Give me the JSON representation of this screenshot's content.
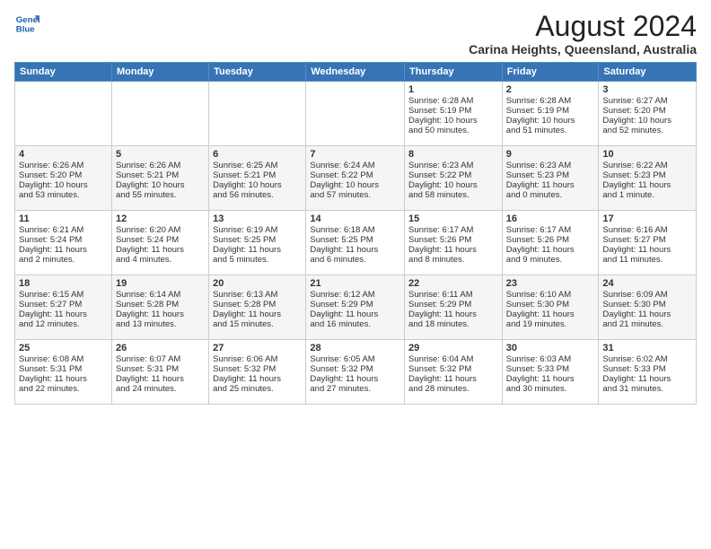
{
  "header": {
    "logo_line1": "General",
    "logo_line2": "Blue",
    "main_title": "August 2024",
    "sub_title": "Carina Heights, Queensland, Australia"
  },
  "days_of_week": [
    "Sunday",
    "Monday",
    "Tuesday",
    "Wednesday",
    "Thursday",
    "Friday",
    "Saturday"
  ],
  "weeks": [
    [
      {
        "day": "",
        "content": ""
      },
      {
        "day": "",
        "content": ""
      },
      {
        "day": "",
        "content": ""
      },
      {
        "day": "",
        "content": ""
      },
      {
        "day": "1",
        "content": "Sunrise: 6:28 AM\nSunset: 5:19 PM\nDaylight: 10 hours\nand 50 minutes."
      },
      {
        "day": "2",
        "content": "Sunrise: 6:28 AM\nSunset: 5:19 PM\nDaylight: 10 hours\nand 51 minutes."
      },
      {
        "day": "3",
        "content": "Sunrise: 6:27 AM\nSunset: 5:20 PM\nDaylight: 10 hours\nand 52 minutes."
      }
    ],
    [
      {
        "day": "4",
        "content": "Sunrise: 6:26 AM\nSunset: 5:20 PM\nDaylight: 10 hours\nand 53 minutes."
      },
      {
        "day": "5",
        "content": "Sunrise: 6:26 AM\nSunset: 5:21 PM\nDaylight: 10 hours\nand 55 minutes."
      },
      {
        "day": "6",
        "content": "Sunrise: 6:25 AM\nSunset: 5:21 PM\nDaylight: 10 hours\nand 56 minutes."
      },
      {
        "day": "7",
        "content": "Sunrise: 6:24 AM\nSunset: 5:22 PM\nDaylight: 10 hours\nand 57 minutes."
      },
      {
        "day": "8",
        "content": "Sunrise: 6:23 AM\nSunset: 5:22 PM\nDaylight: 10 hours\nand 58 minutes."
      },
      {
        "day": "9",
        "content": "Sunrise: 6:23 AM\nSunset: 5:23 PM\nDaylight: 11 hours\nand 0 minutes."
      },
      {
        "day": "10",
        "content": "Sunrise: 6:22 AM\nSunset: 5:23 PM\nDaylight: 11 hours\nand 1 minute."
      }
    ],
    [
      {
        "day": "11",
        "content": "Sunrise: 6:21 AM\nSunset: 5:24 PM\nDaylight: 11 hours\nand 2 minutes."
      },
      {
        "day": "12",
        "content": "Sunrise: 6:20 AM\nSunset: 5:24 PM\nDaylight: 11 hours\nand 4 minutes."
      },
      {
        "day": "13",
        "content": "Sunrise: 6:19 AM\nSunset: 5:25 PM\nDaylight: 11 hours\nand 5 minutes."
      },
      {
        "day": "14",
        "content": "Sunrise: 6:18 AM\nSunset: 5:25 PM\nDaylight: 11 hours\nand 6 minutes."
      },
      {
        "day": "15",
        "content": "Sunrise: 6:17 AM\nSunset: 5:26 PM\nDaylight: 11 hours\nand 8 minutes."
      },
      {
        "day": "16",
        "content": "Sunrise: 6:17 AM\nSunset: 5:26 PM\nDaylight: 11 hours\nand 9 minutes."
      },
      {
        "day": "17",
        "content": "Sunrise: 6:16 AM\nSunset: 5:27 PM\nDaylight: 11 hours\nand 11 minutes."
      }
    ],
    [
      {
        "day": "18",
        "content": "Sunrise: 6:15 AM\nSunset: 5:27 PM\nDaylight: 11 hours\nand 12 minutes."
      },
      {
        "day": "19",
        "content": "Sunrise: 6:14 AM\nSunset: 5:28 PM\nDaylight: 11 hours\nand 13 minutes."
      },
      {
        "day": "20",
        "content": "Sunrise: 6:13 AM\nSunset: 5:28 PM\nDaylight: 11 hours\nand 15 minutes."
      },
      {
        "day": "21",
        "content": "Sunrise: 6:12 AM\nSunset: 5:29 PM\nDaylight: 11 hours\nand 16 minutes."
      },
      {
        "day": "22",
        "content": "Sunrise: 6:11 AM\nSunset: 5:29 PM\nDaylight: 11 hours\nand 18 minutes."
      },
      {
        "day": "23",
        "content": "Sunrise: 6:10 AM\nSunset: 5:30 PM\nDaylight: 11 hours\nand 19 minutes."
      },
      {
        "day": "24",
        "content": "Sunrise: 6:09 AM\nSunset: 5:30 PM\nDaylight: 11 hours\nand 21 minutes."
      }
    ],
    [
      {
        "day": "25",
        "content": "Sunrise: 6:08 AM\nSunset: 5:31 PM\nDaylight: 11 hours\nand 22 minutes."
      },
      {
        "day": "26",
        "content": "Sunrise: 6:07 AM\nSunset: 5:31 PM\nDaylight: 11 hours\nand 24 minutes."
      },
      {
        "day": "27",
        "content": "Sunrise: 6:06 AM\nSunset: 5:32 PM\nDaylight: 11 hours\nand 25 minutes."
      },
      {
        "day": "28",
        "content": "Sunrise: 6:05 AM\nSunset: 5:32 PM\nDaylight: 11 hours\nand 27 minutes."
      },
      {
        "day": "29",
        "content": "Sunrise: 6:04 AM\nSunset: 5:32 PM\nDaylight: 11 hours\nand 28 minutes."
      },
      {
        "day": "30",
        "content": "Sunrise: 6:03 AM\nSunset: 5:33 PM\nDaylight: 11 hours\nand 30 minutes."
      },
      {
        "day": "31",
        "content": "Sunrise: 6:02 AM\nSunset: 5:33 PM\nDaylight: 11 hours\nand 31 minutes."
      }
    ]
  ]
}
